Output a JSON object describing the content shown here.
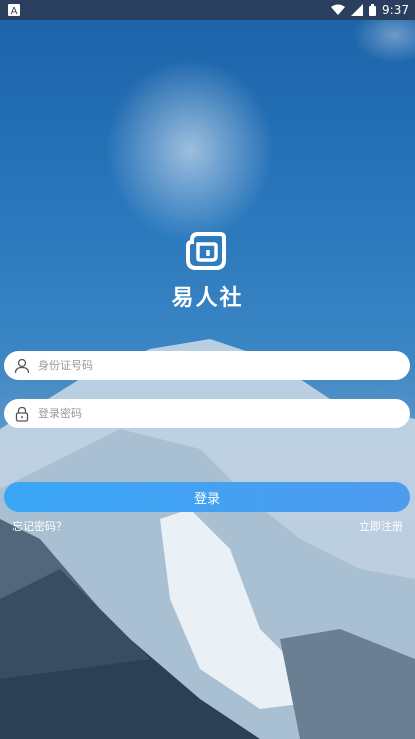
{
  "status": {
    "time": "9:37"
  },
  "app": {
    "name": "易人社"
  },
  "form": {
    "id_placeholder": "身份证号码",
    "password_placeholder": "登录密码",
    "login_label": "登录",
    "forgot_label": "忘记密码？",
    "register_label": "立即注册"
  },
  "colors": {
    "button_start": "#3aa7f5",
    "button_end": "#4e9bf0"
  }
}
